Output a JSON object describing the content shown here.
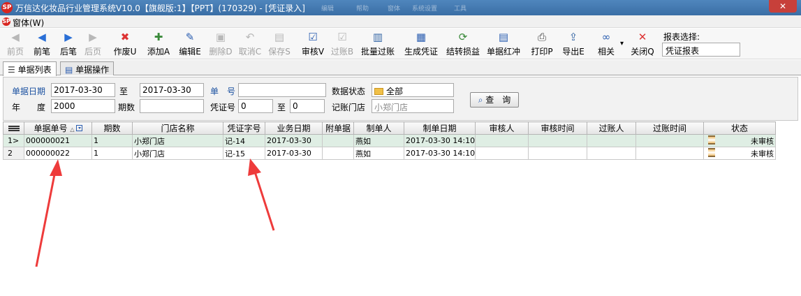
{
  "window": {
    "title": "万信达化妆品行业管理系统V10.0【旗舰版:1】【PPT】(170329) - [凭证录入]",
    "close_symbol": "✕",
    "ghost_menu": [
      "编辑",
      "帮助",
      "窗体",
      "系统设置",
      "工具"
    ]
  },
  "menu": {
    "items": [
      "窗体(W)"
    ]
  },
  "toolbar": {
    "buttons": [
      {
        "label": "前页",
        "icon": "first-page-icon",
        "glyph": "◀",
        "enabled": false
      },
      {
        "label": "前笔",
        "icon": "prev-record-icon",
        "glyph": "◀",
        "enabled": true
      },
      {
        "label": "后笔",
        "icon": "next-record-icon",
        "glyph": "▶",
        "enabled": true
      },
      {
        "label": "后页",
        "icon": "last-page-icon",
        "glyph": "▶",
        "enabled": false
      },
      {
        "label": "作废U",
        "icon": "void-icon",
        "glyph": "✖",
        "enabled": true
      },
      {
        "label": "添加A",
        "icon": "add-icon",
        "glyph": "✚",
        "enabled": true
      },
      {
        "label": "编辑E",
        "icon": "edit-icon",
        "glyph": "✎",
        "enabled": true
      },
      {
        "label": "删除D",
        "icon": "delete-icon",
        "glyph": "▣",
        "enabled": false
      },
      {
        "label": "取消C",
        "icon": "undo-icon",
        "glyph": "↶",
        "enabled": false
      },
      {
        "label": "保存S",
        "icon": "save-icon",
        "glyph": "▤",
        "enabled": false
      },
      {
        "label": "审核V",
        "icon": "approve-icon",
        "glyph": "☑",
        "enabled": true
      },
      {
        "label": "过账B",
        "icon": "post-icon",
        "glyph": "☑",
        "enabled": false
      },
      {
        "label": "批量过账",
        "icon": "batch-post-icon",
        "glyph": "▥",
        "enabled": true
      },
      {
        "label": "生成凭证",
        "icon": "generate-voucher-icon",
        "glyph": "▦",
        "enabled": true
      },
      {
        "label": "结转损益",
        "icon": "carry-forward-icon",
        "glyph": "⟳",
        "enabled": true
      },
      {
        "label": "单据红冲",
        "icon": "red-reversal-icon",
        "glyph": "▤",
        "enabled": true
      },
      {
        "label": "打印P",
        "icon": "print-icon",
        "glyph": "⎙",
        "enabled": true
      },
      {
        "label": "导出E",
        "icon": "export-icon",
        "glyph": "⇪",
        "enabled": true
      },
      {
        "label": "相关",
        "icon": "related-link-icon",
        "glyph": "∞",
        "enabled": true
      },
      {
        "label": "关闭Q",
        "icon": "close-icon",
        "glyph": "✕",
        "enabled": true
      }
    ],
    "dropdown_glyph": "▾",
    "report_select_label": "报表选择:",
    "report_select_value": "凭证报表"
  },
  "tabs": [
    {
      "label": "单据列表",
      "active": true
    },
    {
      "label": "单据操作",
      "active": false
    }
  ],
  "filter": {
    "bill_date_label": "单据日期",
    "date_from": "2017-03-30",
    "to_label": "至",
    "date_to": "2017-03-30",
    "bill_no_label": "单　号",
    "bill_no": "",
    "status_label": "数据状态",
    "status_value": "全部",
    "year_label": "年　　度",
    "year": "2000",
    "period_label": "期数",
    "period": "",
    "voucher_no_label": "凭证号",
    "voucher_from": "0",
    "voucher_to_label": "至",
    "voucher_to": "0",
    "posting_store_label": "记账门店",
    "posting_store": "小郑门店",
    "query_button": "查　询"
  },
  "grid": {
    "columns": [
      "",
      "单据单号",
      "期数",
      "门店名称",
      "凭证字号",
      "业务日期",
      "附单据",
      "制单人",
      "制单日期",
      "审核人",
      "审核时间",
      "过账人",
      "过账时间",
      "状态"
    ],
    "rows": [
      {
        "rownum": "1>",
        "bill_no": "000000021",
        "period": "1",
        "store": "小郑门店",
        "voucher": "记-14",
        "biz_date": "2017-03-30",
        "attachments": "",
        "maker": "燕如",
        "make_date": "2017-03-30 14:10",
        "auditor": "",
        "audit_time": "",
        "poster": "",
        "post_time": "",
        "status": "未审核"
      },
      {
        "rownum": "2",
        "bill_no": "000000022",
        "period": "1",
        "store": "小郑门店",
        "voucher": "记-15",
        "biz_date": "2017-03-30",
        "attachments": "",
        "maker": "燕如",
        "make_date": "2017-03-30 14:10",
        "auditor": "",
        "audit_time": "",
        "poster": "",
        "post_time": "",
        "status": "未审核"
      }
    ]
  },
  "colors": {
    "annotation_arrow": "#ee3b3b",
    "selected_row": "#dfeee4",
    "title_bar": "#3a6ea5"
  }
}
